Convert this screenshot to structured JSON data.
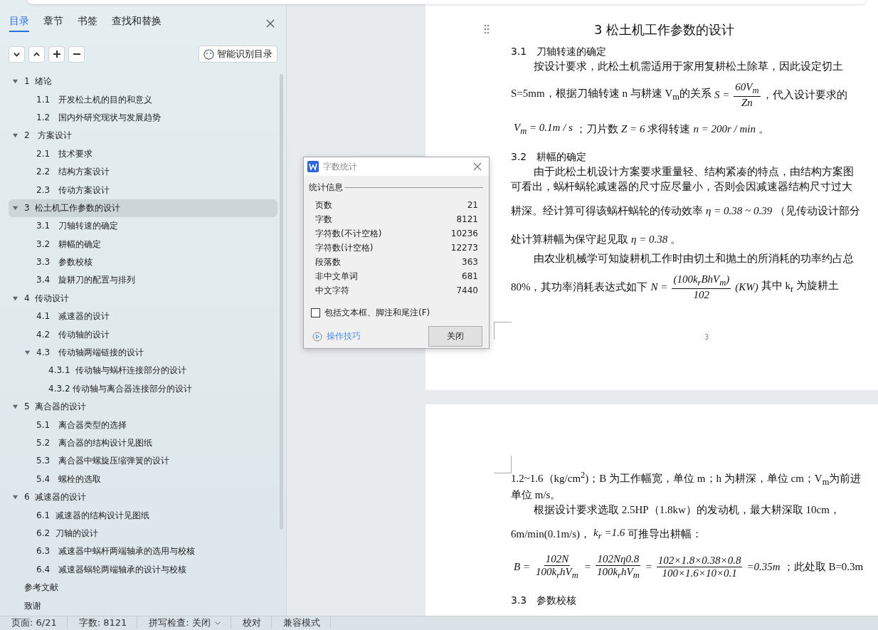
{
  "nav_panel": {
    "tabs": [
      {
        "label": "目录",
        "selected": true
      },
      {
        "label": "章节",
        "selected": false
      },
      {
        "label": "书签",
        "selected": false
      },
      {
        "label": "查找和替换",
        "selected": false
      }
    ],
    "smart_button": "智能识别目录",
    "toc": {
      "items": [
        {
          "label": "1  绪论",
          "expanded": true,
          "selected": false,
          "children": [
            {
              "label": "1.1   开发松土机的目的和意义",
              "selected": false
            },
            {
              "label": "1.2   国内外研究现状与发展趋势",
              "selected": false
            }
          ]
        },
        {
          "label": "2   方案设计",
          "expanded": true,
          "selected": false,
          "children": [
            {
              "label": "2.1   技术要求",
              "selected": false
            },
            {
              "label": "2.2   结构方案设计",
              "selected": false
            },
            {
              "label": "2.3   传动方案设计",
              "selected": false
            }
          ]
        },
        {
          "label": "3  松土机工作参数的设计",
          "expanded": true,
          "selected": true,
          "children": [
            {
              "label": "3.1   刀轴转速的确定",
              "selected": false
            },
            {
              "label": "3.2   耕幅的确定",
              "selected": false
            },
            {
              "label": "3.3   参数校核",
              "selected": false
            },
            {
              "label": "3.4   旋耕刀的配置与排列",
              "selected": false
            }
          ]
        },
        {
          "label": "4  传动设计",
          "expanded": true,
          "selected": false,
          "children": [
            {
              "label": "4.1   减速器的设计",
              "selected": false
            },
            {
              "label": "4.2   传动轴的设计",
              "selected": false
            },
            {
              "label": "4.3   传动轴两端链接的设计",
              "expanded": true,
              "selected": false,
              "children": [
                {
                  "label": "4.3.1  传动轴与蜗杆连接部分的设计",
                  "selected": false
                },
                {
                  "label": "4.3.2 传动轴与离合器连接部分的设计",
                  "selected": false
                }
              ]
            }
          ]
        },
        {
          "label": "5  离合器的设计",
          "expanded": true,
          "selected": false,
          "children": [
            {
              "label": "5.1   离合器类型的选择",
              "selected": false
            },
            {
              "label": "5.2   离合器的结构设计见图纸",
              "selected": false
            },
            {
              "label": "5.3   离合器中螺旋压缩弹簧的设计",
              "selected": false
            },
            {
              "label": "5.4   螺栓的选取",
              "selected": false
            }
          ]
        },
        {
          "label": "6  减速器的设计",
          "expanded": true,
          "selected": false,
          "children": [
            {
              "label": "6.1  减速器的结构设计见图纸",
              "selected": false
            },
            {
              "label": "6.2  刀轴的设计",
              "selected": false
            },
            {
              "label": "6.3   减速器中蜗杆两端轴承的选用与校核",
              "selected": false
            },
            {
              "label": "6.4   减速器蜗轮两端轴承的设计与校核",
              "selected": false
            }
          ]
        },
        {
          "label": "参考文献",
          "selected": false
        },
        {
          "label": "致谢",
          "selected": false
        }
      ]
    }
  },
  "document": {
    "pages": [
      {
        "lines": [
          {
            "kind": "title",
            "text": "3  松土机工作参数的设计"
          },
          {
            "kind": "section",
            "text": "3.1　刀轴转速的确定"
          },
          {
            "kind": "para",
            "segments": [
              {
                "kind": "text",
                "text": "按设计要求，此松土机需适用于家用复耕松土除草，因此设定切土"
              }
            ]
          },
          {
            "kind": "line",
            "segments": [
              {
                "kind": "text",
                "text": "S=5mm，根据刀轴转速 n 与耕速 V$_{m}$的关系"
              },
              {
                "kind": "math",
                "text": "S ="
              },
              {
                "kind": "frac",
                "num": "60V$_{m}$",
                "den": "Zn"
              },
              {
                "kind": "text",
                "text": "，代入设计要求的"
              }
            ]
          },
          {
            "kind": "line",
            "segments": [
              {
                "kind": "math",
                "text": "V$_{m}$ = 0.1m / s"
              },
              {
                "kind": "text",
                "text": "；刀片数"
              },
              {
                "kind": "math",
                "text": "Z = 6"
              },
              {
                "kind": "text",
                "text": "求得转速"
              },
              {
                "kind": "math",
                "text": "n = 200r / min"
              },
              {
                "kind": "text",
                "text": "。"
              }
            ]
          },
          {
            "kind": "section",
            "text": "3.2　耕幅的确定"
          },
          {
            "kind": "para",
            "segments": [
              {
                "kind": "text",
                "text": "由于此松土机设计方案要求重量轻、结构紧凑的特点，由结构方案图"
              }
            ]
          },
          {
            "kind": "line",
            "segments": [
              {
                "kind": "text",
                "text": "可看出，蜗杆蜗轮减速器的尺寸应尽量小，否则会因减速器结构尺寸过大"
              }
            ]
          },
          {
            "kind": "line",
            "segments": [
              {
                "kind": "text",
                "text": "耕深。经计算可得该蜗杆蜗轮的传动效率"
              },
              {
                "kind": "math",
                "text": "η = 0.38 ~ 0.39"
              },
              {
                "kind": "text",
                "text": "（见传动设计部分"
              }
            ]
          },
          {
            "kind": "line",
            "segments": [
              {
                "kind": "text",
                "text": "处计算耕幅为保守起见取"
              },
              {
                "kind": "math",
                "text": "η = 0.38"
              },
              {
                "kind": "text",
                "text": "。"
              }
            ]
          },
          {
            "kind": "para",
            "segments": [
              {
                "kind": "text",
                "text": "由农业机械学可知旋耕机工作时由切土和抛土的所消耗的功率约占总"
              }
            ]
          },
          {
            "kind": "line",
            "segments": [
              {
                "kind": "text",
                "text": "80%，其功率消耗表达式如下"
              },
              {
                "kind": "math",
                "text": "N ="
              },
              {
                "kind": "frac",
                "num": "(100k$_{r}$BhV$_{m}$)",
                "den": "102"
              },
              {
                "kind": "math",
                "text": "(KW)"
              },
              {
                "kind": "text",
                "text": "其中 k$_{r}$ 为旋耕土"
              }
            ]
          }
        ],
        "page_number": "3"
      },
      {
        "lines": [
          {
            "kind": "line",
            "segments": [
              {
                "kind": "text",
                "text": "1.2~1.6（kg/cm$^{2}$)；B 为工作幅宽，单位 m；h 为耕深，单位 cm；V$_{m}$为前进"
              }
            ]
          },
          {
            "kind": "line",
            "segments": [
              {
                "kind": "text",
                "text": "单位 m/s。"
              }
            ]
          },
          {
            "kind": "para",
            "segments": [
              {
                "kind": "text",
                "text": "根据设计要求选取 2.5HP（1.8kw）的发动机，最大耕深取 10cm，"
              }
            ]
          },
          {
            "kind": "line",
            "segments": [
              {
                "kind": "text",
                "text": "6m/min(0.1m/s)，"
              },
              {
                "kind": "math",
                "text": "k$_{r}$ =1.6"
              },
              {
                "kind": "text",
                "text": "可推导出耕幅："
              }
            ]
          },
          {
            "kind": "line",
            "segments": [
              {
                "kind": "math",
                "text": "B ="
              },
              {
                "kind": "frac",
                "num": "102N",
                "den": "100k$_{r}$hV$_{m}$"
              },
              {
                "kind": "math",
                "text": "="
              },
              {
                "kind": "frac",
                "num": "102Nη0.8",
                "den": "100k$_{r}$hV$_{m}$"
              },
              {
                "kind": "math",
                "text": "="
              },
              {
                "kind": "frac",
                "num": "102×1.8×0.38×0.8",
                "den": "100×1.6×10×0.1"
              },
              {
                "kind": "math",
                "text": "=0.35m"
              },
              {
                "kind": "text",
                "text": "；"
              },
              {
                "kind": "text",
                "text": "此处取 B=0.3m"
              }
            ]
          },
          {
            "kind": "section",
            "text": "3.3　参数校核"
          }
        ]
      }
    ]
  },
  "dialog": {
    "title": "字数统计",
    "group": "统计信息",
    "stats": [
      {
        "label": "页数",
        "value": "21"
      },
      {
        "label": "字数",
        "value": "8121"
      },
      {
        "label": "字符数(不计空格)",
        "value": "10236"
      },
      {
        "label": "字符数(计空格)",
        "value": "12273"
      },
      {
        "label": "段落数",
        "value": "363"
      },
      {
        "label": "非中文单词",
        "value": "681"
      },
      {
        "label": "中文字符",
        "value": "7440"
      }
    ],
    "checkbox": {
      "label": "包括文本框、脚注和尾注(F)",
      "checked": false
    },
    "tips_link": "操作技巧",
    "close_button": "关闭"
  },
  "status_bar": [
    {
      "text": "页面: 6/21",
      "dropdown": false
    },
    {
      "text": "字数: 8121",
      "dropdown": false
    },
    {
      "text": "拼写检查: 关闭",
      "dropdown": true
    },
    {
      "text": "校对",
      "dropdown": false
    },
    {
      "text": "兼容模式",
      "dropdown": false
    }
  ]
}
